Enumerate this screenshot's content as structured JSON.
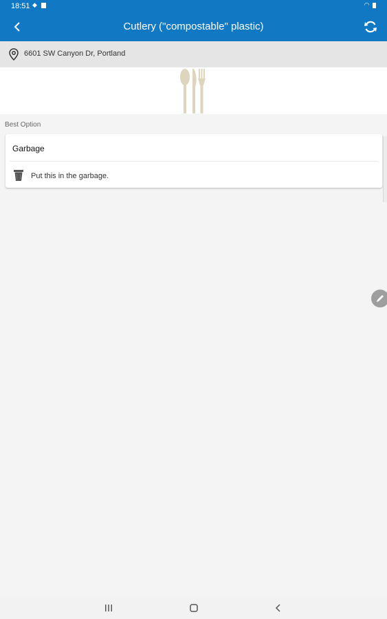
{
  "status_bar": {
    "time": "18:51",
    "left_icons": [
      "notification-icon",
      "image-icon"
    ],
    "right_icons": [
      "wifi-icon",
      "battery-icon"
    ]
  },
  "app_bar": {
    "title": "Cutlery (\"compostable\" plastic)",
    "back_icon": "chevron-left-icon",
    "refresh_icon": "refresh-icon"
  },
  "location": {
    "icon": "location-pin-icon",
    "address": "6601 SW Canyon Dr, Portland"
  },
  "hero": {
    "image": "cutlery-image"
  },
  "section": {
    "label": "Best Option"
  },
  "card": {
    "title": "Garbage",
    "icon": "garbage-bin-icon",
    "description": "Put this in the garbage."
  },
  "fab": {
    "icon": "edit-pencil-icon"
  },
  "nav_bar": {
    "items": [
      "recent-apps-icon",
      "home-icon",
      "back-icon"
    ]
  },
  "colors": {
    "primary": "#1178c4",
    "background": "#f4f4f4",
    "location_bar": "#e5e5e5",
    "cutlery": "#ddd5bd"
  }
}
